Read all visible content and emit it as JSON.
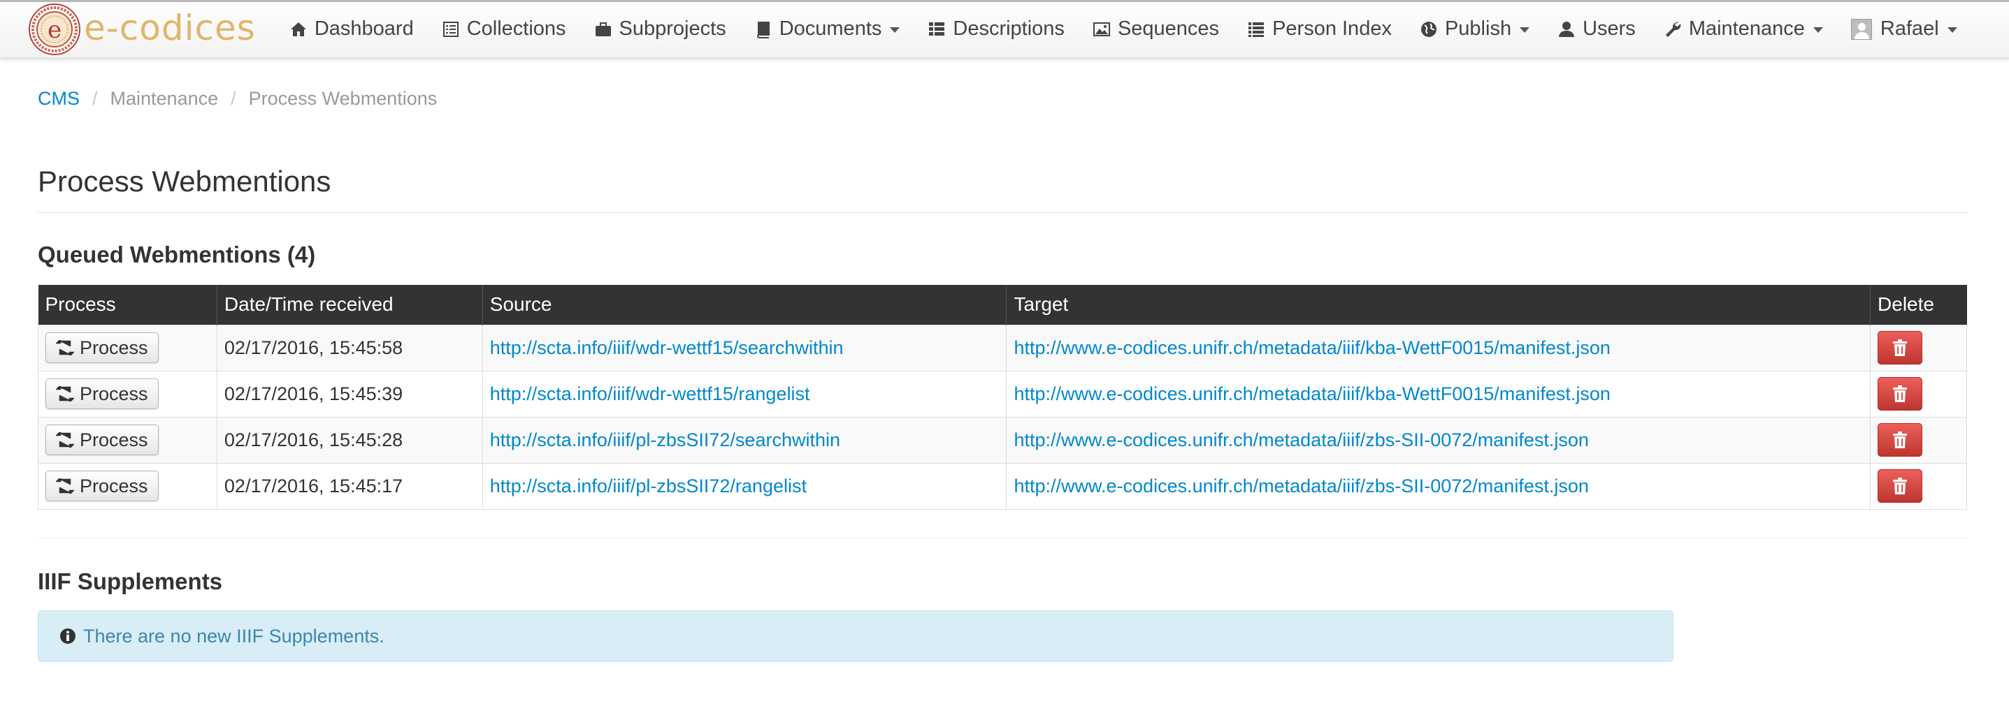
{
  "brand": {
    "name": "e-codices"
  },
  "nav": {
    "items": [
      {
        "label": "Dashboard",
        "icon": "home-icon",
        "dropdown": false
      },
      {
        "label": "Collections",
        "icon": "list-alt-icon",
        "dropdown": false
      },
      {
        "label": "Subprojects",
        "icon": "briefcase-icon",
        "dropdown": false
      },
      {
        "label": "Documents",
        "icon": "book-icon",
        "dropdown": true
      },
      {
        "label": "Descriptions",
        "icon": "th-list-icon",
        "dropdown": false
      },
      {
        "label": "Sequences",
        "icon": "picture-icon",
        "dropdown": false
      },
      {
        "label": "Person Index",
        "icon": "list-icon",
        "dropdown": false
      },
      {
        "label": "Publish",
        "icon": "globe-icon",
        "dropdown": true
      },
      {
        "label": "Users",
        "icon": "user-icon",
        "dropdown": false
      },
      {
        "label": "Maintenance",
        "icon": "wrench-icon",
        "dropdown": true
      }
    ],
    "user": {
      "label": "Rafael",
      "icon": "avatar"
    }
  },
  "breadcrumb": {
    "items": [
      "CMS",
      "Maintenance",
      "Process Webmentions"
    ],
    "separator": "/"
  },
  "page": {
    "title": "Process Webmentions"
  },
  "queue": {
    "heading": "Queued Webmentions (4)",
    "columns": [
      "Process",
      "Date/Time received",
      "Source",
      "Target",
      "Delete"
    ],
    "process_label": "Process",
    "rows": [
      {
        "date": "02/17/2016, 15:45:58",
        "source": "http://scta.info/iiif/wdr-wettf15/searchwithin",
        "target": "http://www.e-codices.unifr.ch/metadata/iiif/kba-WettF0015/manifest.json"
      },
      {
        "date": "02/17/2016, 15:45:39",
        "source": "http://scta.info/iiif/wdr-wettf15/rangelist",
        "target": "http://www.e-codices.unifr.ch/metadata/iiif/kba-WettF0015/manifest.json"
      },
      {
        "date": "02/17/2016, 15:45:28",
        "source": "http://scta.info/iiif/pl-zbsSII72/searchwithin",
        "target": "http://www.e-codices.unifr.ch/metadata/iiif/zbs-SII-0072/manifest.json"
      },
      {
        "date": "02/17/2016, 15:45:17",
        "source": "http://scta.info/iiif/pl-zbsSII72/rangelist",
        "target": "http://www.e-codices.unifr.ch/metadata/iiif/zbs-SII-0072/manifest.json"
      }
    ]
  },
  "supplements": {
    "heading": "IIIF Supplements",
    "message": "There are no new IIIF Supplements."
  },
  "colors": {
    "link": "#0088cc",
    "table_header": "#333333",
    "danger": "#da4f49",
    "info_bg": "#d9edf7",
    "info_text": "#3a87ad",
    "brand": "#e0b56a"
  }
}
